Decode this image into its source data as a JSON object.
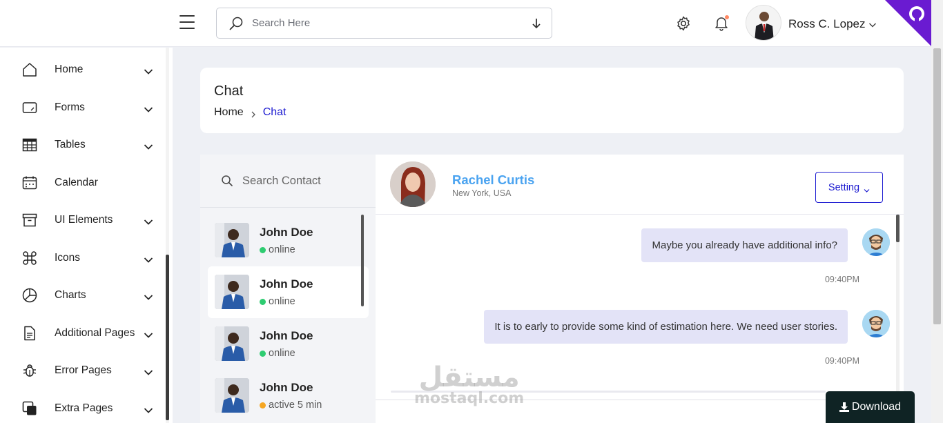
{
  "topbar": {
    "search_placeholder": "Search Here",
    "user_name": "Ross C. Lopez"
  },
  "sidebar": {
    "items": [
      {
        "label": "Home",
        "icon": "home-icon",
        "has_children": true
      },
      {
        "label": "Forms",
        "icon": "form-icon",
        "has_children": true
      },
      {
        "label": "Tables",
        "icon": "table-icon",
        "has_children": true
      },
      {
        "label": "Calendar",
        "icon": "calendar-icon",
        "has_children": false
      },
      {
        "label": "UI Elements",
        "icon": "archive-icon",
        "has_children": true
      },
      {
        "label": "Icons",
        "icon": "command-icon",
        "has_children": true
      },
      {
        "label": "Charts",
        "icon": "pie-chart-icon",
        "has_children": true
      },
      {
        "label": "Additional Pages",
        "icon": "document-icon",
        "has_children": true
      },
      {
        "label": "Error Pages",
        "icon": "bug-icon",
        "has_children": true
      },
      {
        "label": "Extra Pages",
        "icon": "layers-icon",
        "has_children": true
      }
    ]
  },
  "breadcrumb": {
    "title": "Chat",
    "home": "Home",
    "current": "Chat"
  },
  "contacts": {
    "search_placeholder": "Search Contact",
    "items": [
      {
        "name": "John Doe",
        "status": "online",
        "status_color": "#2ecc71",
        "active": false
      },
      {
        "name": "John Doe",
        "status": "online",
        "status_color": "#2ecc71",
        "active": true
      },
      {
        "name": "John Doe",
        "status": "online",
        "status_color": "#2ecc71",
        "active": false
      },
      {
        "name": "John Doe",
        "status": "active 5 min",
        "status_color": "#f5a623",
        "active": false
      }
    ]
  },
  "chat": {
    "contact_name": "Rachel Curtis",
    "contact_location": "New York, USA",
    "setting_label": "Setting",
    "messages": [
      {
        "text": "Maybe you already have additional info?",
        "time": "09:40PM"
      },
      {
        "text": "It is to early to provide some kind of estimation here. We need user stories.",
        "time": "09:40PM"
      }
    ]
  },
  "watermark": {
    "arabic": "مستقل",
    "latin": "mostaql.com"
  },
  "download_label": "Download",
  "colors": {
    "accent": "#1d1bd1",
    "contact_name": "#4aa3f0",
    "bubble": "#e3e3f7",
    "github_corner": "#6a1bd1"
  }
}
